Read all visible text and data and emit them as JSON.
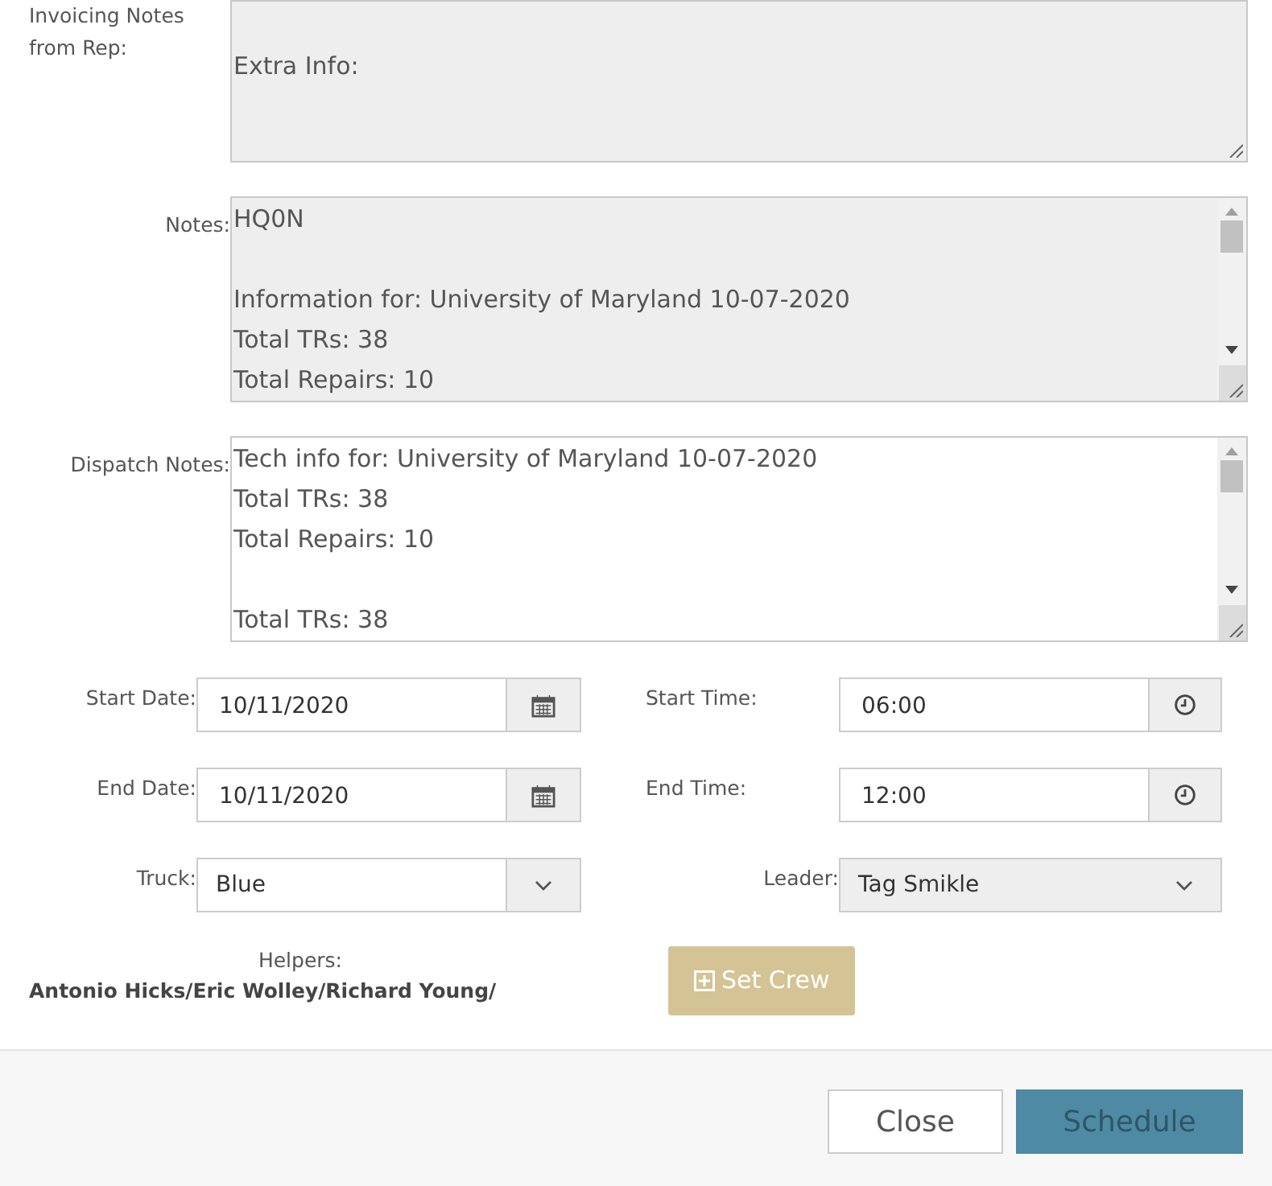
{
  "notes_fields": [
    {
      "label": "Invoicing Notes from Rep:",
      "paragraphs": [
        [
          "Extra Info:"
        ]
      ],
      "disabled": true,
      "scrollbar": false
    },
    {
      "label": "Notes:",
      "paragraphs": [
        [
          "HQ0N"
        ],
        [
          "Information for: University of Maryland 10-07-2020",
          "Total TRs: 38",
          "Total Repairs: 10"
        ]
      ],
      "disabled": true,
      "scrollbar": true
    },
    {
      "label": "Dispatch Notes:",
      "paragraphs": [
        [
          "Tech info for: University of Maryland 10-07-2020",
          "Total TRs: 38",
          "Total Repairs: 10"
        ],
        [
          "Total TRs: 38"
        ]
      ],
      "disabled": false,
      "scrollbar": true
    }
  ],
  "schedule_rows": [
    {
      "left": {
        "label": "Start Date:",
        "value": "10/11/2020",
        "kind": "date",
        "disabled": false
      },
      "right": {
        "label": "Start Time:",
        "value": "06:00",
        "kind": "time",
        "disabled": false
      }
    },
    {
      "left": {
        "label": "End Date:",
        "value": "10/11/2020",
        "kind": "date",
        "disabled": false
      },
      "right": {
        "label": "End Time:",
        "value": "12:00",
        "kind": "time",
        "disabled": false
      }
    },
    {
      "left": {
        "label": "Truck:",
        "value": "Blue",
        "kind": "select",
        "disabled": false
      },
      "right": {
        "label": "Leader:",
        "value": "Tag Smikle",
        "kind": "select",
        "disabled": true
      }
    }
  ],
  "helpers": {
    "label": "Helpers:",
    "value": "Antonio Hicks/Eric Wolley/Richard Young/"
  },
  "set_crew_button": {
    "label": "Set Crew"
  },
  "footer_buttons": [
    {
      "label": "Close",
      "kind": "default"
    },
    {
      "label": "Schedule",
      "kind": "primary"
    }
  ]
}
